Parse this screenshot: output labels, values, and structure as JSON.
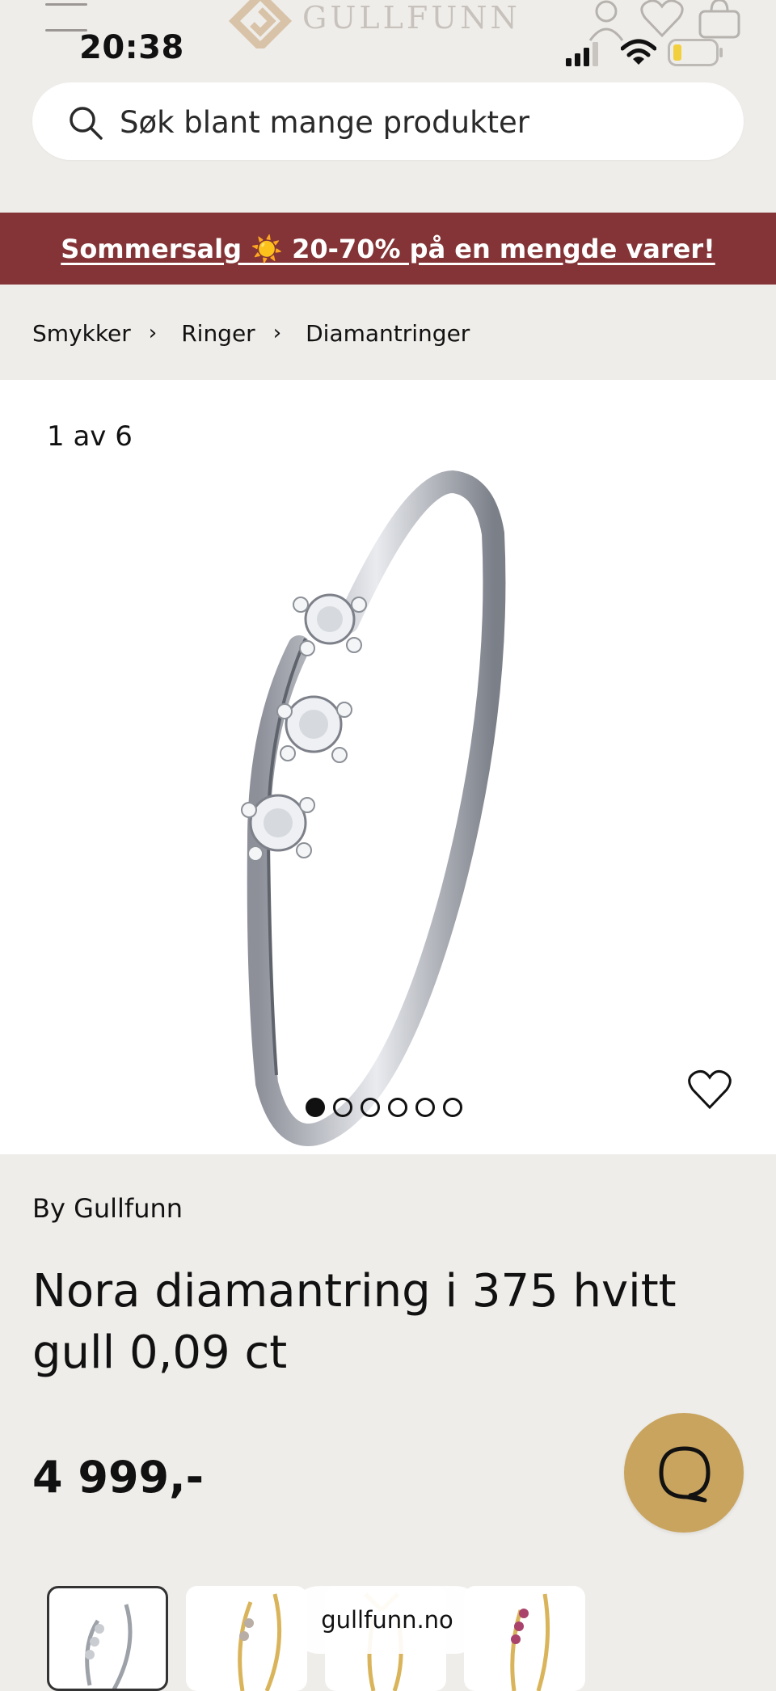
{
  "status_bar": {
    "time": "20:38"
  },
  "header": {
    "brand_name": "GULLFUNN"
  },
  "search": {
    "placeholder": "Søk blant mange produkter"
  },
  "promo": {
    "text": "Sommersalg ☀️ 20-70% på en mengde varer!"
  },
  "breadcrumb": {
    "items": [
      "Smykker",
      "Ringer",
      "Diamantringer"
    ],
    "separator": "›"
  },
  "gallery": {
    "counter": "1 av 6",
    "total_images": 6,
    "current_index": 1
  },
  "product": {
    "brand": "By Gullfunn",
    "title": "Nora diamantring i 375 hvitt gull 0,09 ct",
    "price": "4 999,-"
  },
  "browser": {
    "url": "gullfunn.no"
  },
  "colors": {
    "promo_bg": "#843436",
    "chat_button": "#c9a45e",
    "page_bg": "#efedea"
  },
  "icons": [
    "menu-icon",
    "logo-icon",
    "account-icon",
    "heart-icon",
    "cart-icon",
    "search-icon",
    "favorite-icon",
    "chat-icon"
  ]
}
